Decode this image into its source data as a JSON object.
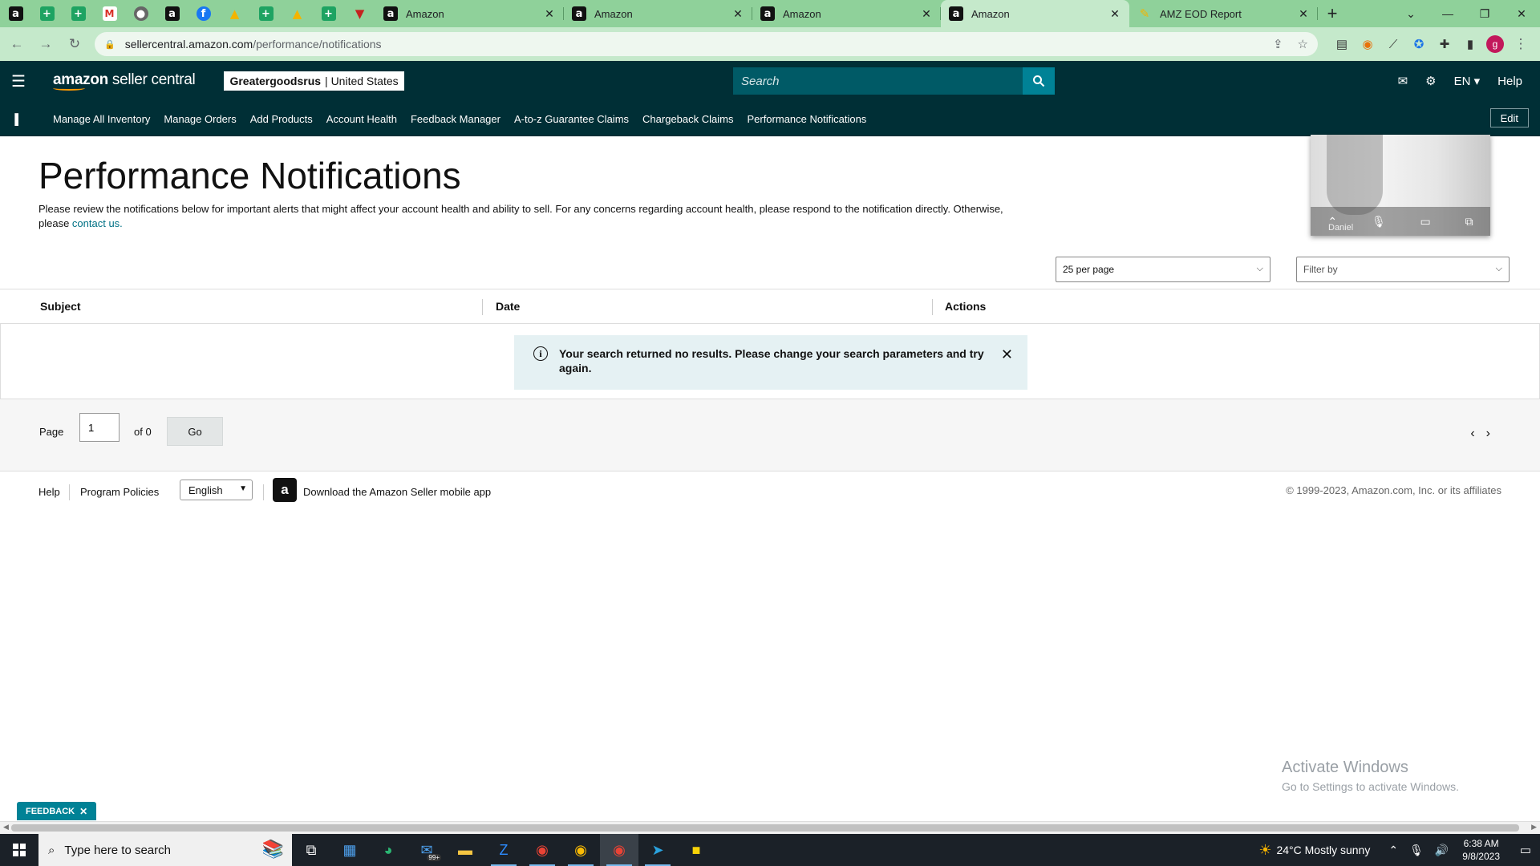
{
  "browser": {
    "pinned_tabs": [
      {
        "icon": "amazon-icon",
        "glyph": "a"
      },
      {
        "icon": "sheets-icon",
        "glyph": "+"
      },
      {
        "icon": "sheets-icon",
        "glyph": "+"
      },
      {
        "icon": "gmail-icon",
        "glyph": "M"
      },
      {
        "icon": "globe-icon",
        "glyph": "●"
      },
      {
        "icon": "amazon-icon",
        "glyph": "a"
      },
      {
        "icon": "facebook-icon",
        "glyph": "f"
      },
      {
        "icon": "drive-icon",
        "glyph": "▲"
      },
      {
        "icon": "sheets-icon",
        "glyph": "+"
      },
      {
        "icon": "drive-icon",
        "glyph": "▲"
      },
      {
        "icon": "sheets-icon",
        "glyph": "+"
      },
      {
        "icon": "extension-icon",
        "glyph": "▼"
      }
    ],
    "tabs": [
      {
        "title": "Amazon",
        "active": false
      },
      {
        "title": "Amazon",
        "active": false
      },
      {
        "title": "Amazon",
        "active": false
      },
      {
        "title": "Amazon",
        "active": true
      },
      {
        "title": "AMZ EOD Report",
        "active": false
      }
    ],
    "url_host": "sellercentral.amazon.com",
    "url_path": "/performance/notifications"
  },
  "header": {
    "logo_bold": "amazon",
    "logo_rest": " seller central",
    "store_name": "Greatergoodsrus",
    "marketplace": "| United States",
    "search_placeholder": "Search",
    "language": "EN ▾",
    "help": "Help"
  },
  "nav": {
    "links": [
      "Manage All Inventory",
      "Manage Orders",
      "Add Products",
      "Account Health",
      "Feedback Manager",
      "A-to-z Guarantee Claims",
      "Chargeback Claims",
      "Performance Notifications"
    ],
    "edit": "Edit"
  },
  "main": {
    "title": "Performance Notifications",
    "intro_text": "Please review the notifications below for important alerts that might affect your account health and ability to sell. For any concerns regarding account health, please respond to the notification directly. Otherwise, please ",
    "intro_link": "contact us.",
    "per_page": "25 per page",
    "filter_placeholder": "Filter by",
    "columns": [
      "Subject",
      "Date",
      "Actions"
    ],
    "alert_message": "Your search returned no results. Please change your search parameters and try again."
  },
  "video_call": {
    "participant": "Daniel"
  },
  "pager": {
    "page_label": "Page",
    "page_value": "1",
    "of_label": "of 0",
    "go": "Go"
  },
  "footer": {
    "help": "Help",
    "program_policies": "Program Policies",
    "language": "English",
    "app_text": "Download the Amazon Seller mobile app",
    "copyright": "© 1999-2023, Amazon.com, Inc. or its affiliates"
  },
  "watermark": {
    "line1": "Activate Windows",
    "line2": "Go to Settings to activate Windows."
  },
  "feedback": {
    "label": "FEEDBACK"
  },
  "taskbar": {
    "search_placeholder": "Type here to search",
    "weather": "24°C  Mostly sunny",
    "time": "6:38 AM",
    "date": "9/8/2023",
    "mail_badge": "99+"
  }
}
